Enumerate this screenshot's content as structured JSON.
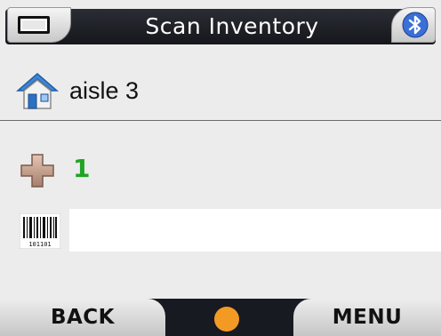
{
  "titlebar": {
    "title": "Scan Inventory",
    "left_icon": "battery-icon",
    "right_icon": "bluetooth-icon"
  },
  "location": {
    "icon": "house-icon",
    "text": "aisle 3"
  },
  "quantity": {
    "icon": "plus-icon",
    "value": "1",
    "color": "#22a325"
  },
  "barcode": {
    "icon": "barcode-icon",
    "icon_caption": "101101",
    "value": ""
  },
  "softkeys": {
    "left_label": "BACK",
    "right_label": "MENU",
    "center_color": "#f39a24"
  }
}
